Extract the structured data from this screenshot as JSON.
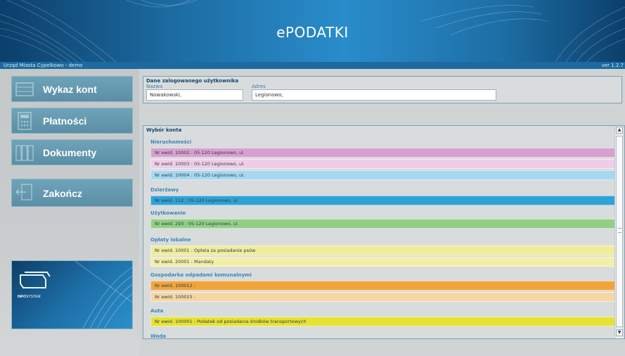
{
  "header": {
    "title": "ePODATKI",
    "organization": "Urząd Miasta Cypelkowo - demo",
    "version": "ver 1.2.7"
  },
  "sidebar": {
    "items": [
      {
        "label": "Wykaz kont",
        "icon": "ledger-icon"
      },
      {
        "label": "Płatności",
        "icon": "calculator-icon"
      },
      {
        "label": "Dokumenty",
        "icon": "binders-icon"
      },
      {
        "label": "Zakończ",
        "icon": "exit-door-icon"
      }
    ],
    "logo": {
      "brand_bold": "INFO",
      "brand_rest": "SYSTEM"
    }
  },
  "user_panel": {
    "title": "Dane zalogowanego użytkownika",
    "name_label": "Nazwa",
    "name_value": "Nowakowski,",
    "address_label": "Adres",
    "address_value": "Legionowo,"
  },
  "accounts": {
    "title": "Wybór konta",
    "groups": [
      {
        "name": "Nieruchomości",
        "rows": [
          {
            "text": "Nr ewid. 10002 : 05-120 Legionowo, ul.",
            "color": "#d9a0cf"
          },
          {
            "text": "Nr ewid. 10003 : 05-120 Legionowo, ul.",
            "color": "#f0cde6"
          },
          {
            "text": "Nr ewid. 10004 : 05-120 Legionowo, ul.",
            "color": "#a7d8ef"
          }
        ]
      },
      {
        "name": "Dzierżawy",
        "rows": [
          {
            "text": "Nr ewid. 112 : 05-120 Legionowo, ul.",
            "color": "#2fa3d6"
          }
        ]
      },
      {
        "name": "Użytkowanie",
        "rows": [
          {
            "text": "Nr ewid. 293 : 05-120 Legionowo, ul.",
            "color": "#92cf85"
          }
        ]
      },
      {
        "name": "Opłaty lokalne",
        "rows": [
          {
            "text": "Nr ewid. 10001 : Opłata za posiadanie psów",
            "color": "#f0ec9a"
          },
          {
            "text": "Nr ewid. 20001 : Mandaty",
            "color": "#f3eea8"
          }
        ]
      },
      {
        "name": "Gospodarka odpadami komunalnymi",
        "rows": [
          {
            "text": "Nr ewid. 100012 :",
            "color": "#f2a43c"
          },
          {
            "text": "Nr ewid. 100015 :",
            "color": "#f5d7a6"
          }
        ]
      },
      {
        "name": "Auta",
        "rows": [
          {
            "text": "Nr ewid. 100001 : Podatek od posiadania środków transportowych",
            "color": "#e6e236"
          }
        ]
      },
      {
        "name": "Woda",
        "rows": []
      }
    ]
  }
}
